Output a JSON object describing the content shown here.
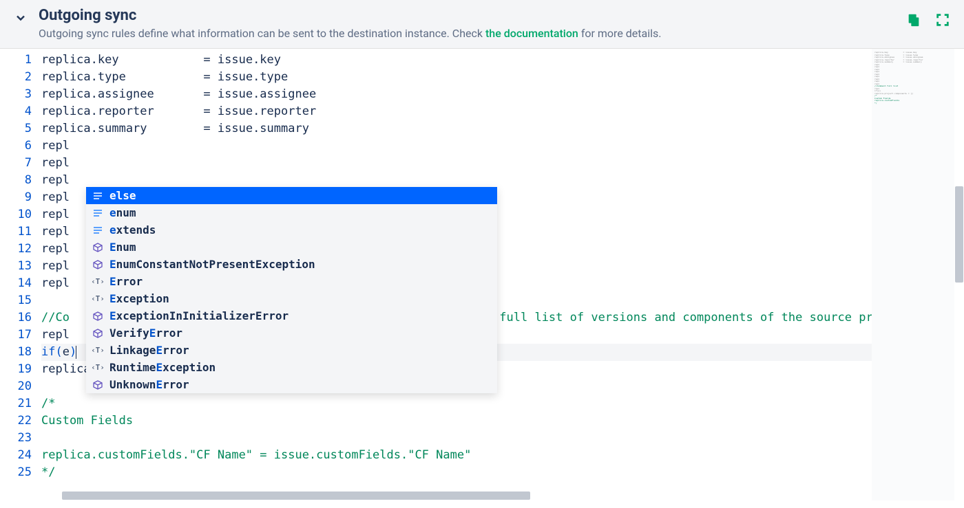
{
  "header": {
    "title": "Outgoing sync",
    "subtitle_before": "Outgoing sync rules define what information can be sent to the destination instance. Check ",
    "subtitle_link": "the documentation",
    "subtitle_after": " for more details."
  },
  "editor": {
    "lines": [
      {
        "n": 1,
        "segs": [
          {
            "t": "replica.key            "
          },
          {
            "t": "=",
            "c": "op"
          },
          {
            "t": " issue.key"
          }
        ]
      },
      {
        "n": 2,
        "segs": [
          {
            "t": "replica.type           "
          },
          {
            "t": "=",
            "c": "op"
          },
          {
            "t": " issue.type"
          }
        ]
      },
      {
        "n": 3,
        "segs": [
          {
            "t": "replica.assignee       "
          },
          {
            "t": "=",
            "c": "op"
          },
          {
            "t": " issue.assignee"
          }
        ]
      },
      {
        "n": 4,
        "segs": [
          {
            "t": "replica.reporter       "
          },
          {
            "t": "=",
            "c": "op"
          },
          {
            "t": " issue.reporter"
          }
        ]
      },
      {
        "n": 5,
        "segs": [
          {
            "t": "replica.summary        "
          },
          {
            "t": "=",
            "c": "op"
          },
          {
            "t": " issue.summary"
          }
        ]
      },
      {
        "n": 6,
        "segs": [
          {
            "t": "repl"
          }
        ]
      },
      {
        "n": 7,
        "segs": [
          {
            "t": "repl"
          }
        ]
      },
      {
        "n": 8,
        "segs": [
          {
            "t": "repl"
          }
        ]
      },
      {
        "n": 9,
        "segs": [
          {
            "t": "repl"
          }
        ]
      },
      {
        "n": 10,
        "segs": [
          {
            "t": "repl"
          }
        ]
      },
      {
        "n": 11,
        "segs": [
          {
            "t": "repl"
          }
        ]
      },
      {
        "n": 12,
        "segs": [
          {
            "t": "repl"
          }
        ]
      },
      {
        "n": 13,
        "segs": [
          {
            "t": "repl"
          }
        ]
      },
      {
        "n": 14,
        "segs": [
          {
            "t": "repl"
          }
        ]
      },
      {
        "n": 15,
        "segs": [
          {
            "t": ""
          }
        ]
      },
      {
        "n": 16,
        "segs": [
          {
            "t": "//Co",
            "c": "comment"
          },
          {
            "t": "                                                             "
          },
          {
            "t": "full list of versions and components of the source proje",
            "c": "comment"
          }
        ]
      },
      {
        "n": 17,
        "segs": [
          {
            "t": "repl"
          }
        ]
      },
      {
        "n": 18,
        "current": true,
        "segs": [
          {
            "t": "if",
            "c": "kw"
          },
          {
            "t": "(",
            "c": "bracket0"
          },
          {
            "t": "e"
          },
          {
            "t": ")",
            "c": "bracket0"
          }
        ],
        "cursor_after": 3
      },
      {
        "n": 19,
        "segs": [
          {
            "t": "replica.project.components "
          },
          {
            "t": "=",
            "c": "op"
          },
          {
            "t": " "
          },
          {
            "t": "[",
            "c": "bracket0"
          },
          {
            "t": "]",
            "c": "bracket0"
          }
        ]
      },
      {
        "n": 20,
        "segs": [
          {
            "t": ""
          }
        ]
      },
      {
        "n": 21,
        "segs": [
          {
            "t": "/*",
            "c": "comment"
          }
        ]
      },
      {
        "n": 22,
        "segs": [
          {
            "t": "Custom Fields",
            "c": "comment"
          }
        ]
      },
      {
        "n": 23,
        "segs": [
          {
            "t": ""
          }
        ]
      },
      {
        "n": 24,
        "segs": [
          {
            "t": "replica.customFields.\"CF Name\" = issue.customFields.\"CF Name\"",
            "c": "comment"
          }
        ]
      },
      {
        "n": 25,
        "segs": [
          {
            "t": "*/",
            "c": "comment"
          }
        ]
      }
    ]
  },
  "autocomplete": {
    "items": [
      {
        "icon": "kw",
        "pre": "e",
        "rest": "lse",
        "selected": true
      },
      {
        "icon": "kw",
        "pre": "e",
        "rest": "num"
      },
      {
        "icon": "kw",
        "pre": "e",
        "rest": "xtends"
      },
      {
        "icon": "class",
        "pre": "E",
        "rest": "num"
      },
      {
        "icon": "class",
        "pre": "E",
        "rest": "numConstantNotPresentException"
      },
      {
        "icon": "type",
        "pre": "E",
        "rest": "rror"
      },
      {
        "icon": "type",
        "pre": "E",
        "rest": "xception"
      },
      {
        "icon": "class",
        "pre": "E",
        "rest": "xceptionInInitializerError"
      },
      {
        "icon": "class",
        "before": "Verify",
        "pre": "E",
        "rest": "rror"
      },
      {
        "icon": "type",
        "before": "Linkage",
        "pre": "E",
        "rest": "rror"
      },
      {
        "icon": "type",
        "before": "Runtime",
        "pre": "E",
        "rest": "xception"
      },
      {
        "icon": "class",
        "before": "Unknown",
        "pre": "E",
        "rest": "rror"
      }
    ]
  },
  "minimap_lines": [
    {
      "t": "replica.key            = issue.key"
    },
    {
      "t": "replica.type           = issue.type"
    },
    {
      "t": "replica.assignee       = issue.assignee"
    },
    {
      "t": "replica.reporter       = issue.reporter"
    },
    {
      "t": "replica.summary        = issue.summary"
    },
    {
      "t": "repl"
    },
    {
      "t": "repl"
    },
    {
      "t": "repl"
    },
    {
      "t": "repl"
    },
    {
      "t": "repl"
    },
    {
      "t": "repl"
    },
    {
      "t": "repl"
    },
    {
      "t": "repl"
    },
    {
      "t": "repl"
    },
    {
      "t": ""
    },
    {
      "t": "//Comment full list",
      "c": "mm-comment"
    },
    {
      "t": "repl"
    },
    {
      "t": "if(e)"
    },
    {
      "t": "replica.project.components = []"
    },
    {
      "t": ""
    },
    {
      "t": "/*",
      "c": "mm-comment"
    },
    {
      "t": "Custom Fields",
      "c": "mm-comment"
    },
    {
      "t": ""
    },
    {
      "t": "replica.customFields",
      "c": "mm-comment"
    },
    {
      "t": "*/",
      "c": "mm-comment"
    }
  ]
}
